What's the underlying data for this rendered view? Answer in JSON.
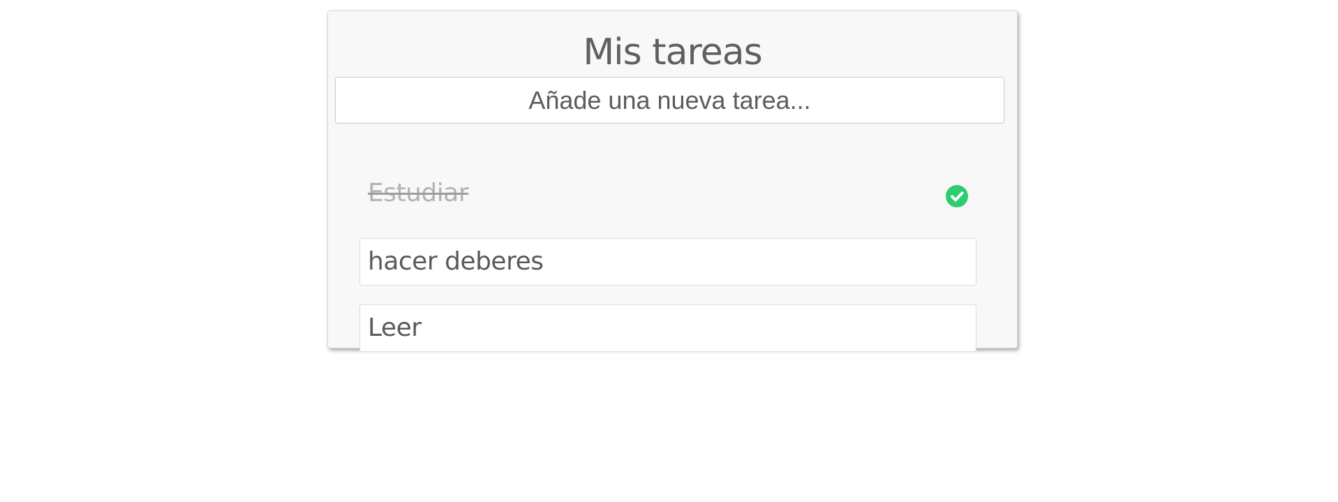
{
  "app": {
    "title": "Mis tareas"
  },
  "new_task": {
    "placeholder": "Añade una nueva tarea...",
    "value": ""
  },
  "tasks": [
    {
      "label": "Estudiar",
      "completed": true
    },
    {
      "label": "hacer deberes",
      "completed": false
    },
    {
      "label": "Leer",
      "completed": false
    }
  ],
  "icons": {
    "completed": "check-circle-icon"
  },
  "colors": {
    "accent_green": "#2ecc71",
    "text": "#5f5f5f",
    "completed_text": "#b3b3b3",
    "card_background": "#f8f8f8"
  }
}
